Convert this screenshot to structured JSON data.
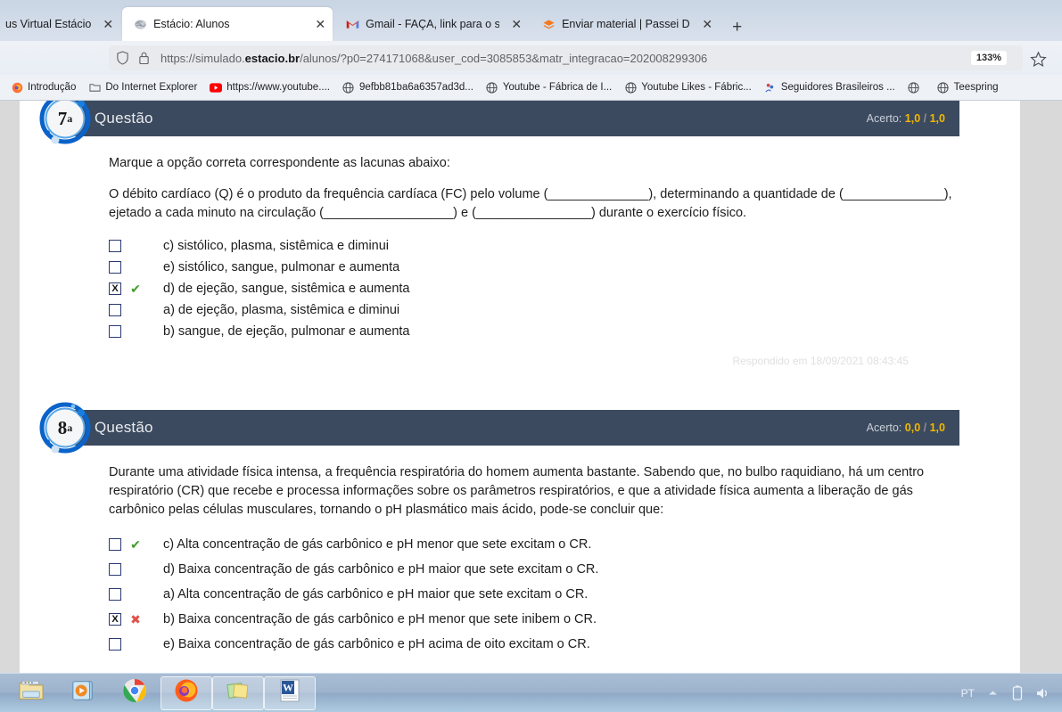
{
  "browser": {
    "tabs": [
      {
        "title": "us Virtual Estácio",
        "favicon": "none-icon",
        "active": false,
        "close_label": "✕"
      },
      {
        "title": "Estácio: Alunos",
        "favicon": "estacio-brain-icon",
        "active": true,
        "close_label": "✕"
      },
      {
        "title": "Gmail - FAÇA, link para o seu ac",
        "favicon": "gmail-icon",
        "active": false,
        "close_label": "✕"
      },
      {
        "title": "Enviar material | Passei Direto | P",
        "favicon": "passeidireto-icon",
        "active": false,
        "close_label": "✕"
      }
    ],
    "new_tab_label": "+",
    "url": {
      "prefix": "https://simulado.",
      "domain": "estacio.br",
      "suffix": "/alunos/?p0=274171068&user_cod=3085853&matr_integracao=202008299306",
      "full": "https://simulado.estacio.br/alunos/?p0=274171068&user_cod=3085853&matr_integracao=202008299306",
      "shield_icon": "shield-icon",
      "lock_icon": "padlock-icon",
      "zoom_level": "133%",
      "bookmark_icon": "star-icon"
    },
    "bookmarks": [
      {
        "label": "Introdução",
        "icon": "firefox-icon"
      },
      {
        "label": "Do Internet Explorer",
        "icon": "folder-icon"
      },
      {
        "label": "https://www.youtube....",
        "icon": "youtube-icon"
      },
      {
        "label": "9efbb81ba6a6357ad3d...",
        "icon": "globe-icon"
      },
      {
        "label": "Youtube - Fábrica de I...",
        "icon": "globe-icon"
      },
      {
        "label": "Youtube Likes - Fábric...",
        "icon": "globe-icon"
      },
      {
        "label": "Seguidores Brasileiros ...",
        "icon": "seguidores-icon"
      },
      {
        "label": "",
        "icon": "globe-icon"
      },
      {
        "label": "Teespring",
        "icon": "globe-icon"
      }
    ]
  },
  "questions": [
    {
      "number": "7",
      "ordinal_suffix": "a",
      "header_label": "Questão",
      "score_label": "Acerto:",
      "score_earned": "1,0",
      "score_separator": "/",
      "score_total": "1,0",
      "statement_lines": [
        "Marque a opção correta correspondente as lacunas abaixo:",
        "O débito cardíaco (Q) é o produto da frequência cardíaca (FC) pelo volume (______________), determinando a quantidade de (______________), ejetado a cada minuto na circulação (__________________) e (________________) durante o exercício físico."
      ],
      "options": [
        {
          "checked": false,
          "mark": "none",
          "label": "c) sistólico, plasma, sistêmica e diminui"
        },
        {
          "checked": false,
          "mark": "none",
          "label": "e) sistólico, sangue, pulmonar e aumenta"
        },
        {
          "checked": true,
          "mark": "correct",
          "label": "d) de ejeção, sangue, sistêmica e aumenta"
        },
        {
          "checked": false,
          "mark": "none",
          "label": "a) de ejeção, plasma, sistêmica e diminui"
        },
        {
          "checked": false,
          "mark": "none",
          "label": "b) sangue, de ejeção, pulmonar e aumenta"
        }
      ],
      "answered_at": "Respondido em 18/09/2021 08:43:45"
    },
    {
      "number": "8",
      "ordinal_suffix": "a",
      "header_label": "Questão",
      "score_label": "Acerto:",
      "score_earned": "0,0",
      "score_separator": "/",
      "score_total": "1,0",
      "statement_lines": [
        "Durante uma atividade física intensa, a frequência respiratória do homem aumenta bastante. Sabendo que, no bulbo raquidiano, há um centro respiratório (CR) que recebe e processa informações sobre os parâmetros respiratórios, e que a atividade física aumenta a liberação de gás carbônico pelas células musculares, tornando o pH plasmático mais ácido, pode-se concluir que:"
      ],
      "options": [
        {
          "checked": false,
          "mark": "correct",
          "label": "c) Alta concentração de gás carbônico e pH menor que sete excitam o CR."
        },
        {
          "checked": false,
          "mark": "none",
          "label": "d) Baixa concentração de gás carbônico e pH maior que sete excitam o CR."
        },
        {
          "checked": false,
          "mark": "none",
          "label": "a) Alta concentração de gás carbônico e pH maior que sete excitam o CR."
        },
        {
          "checked": true,
          "mark": "wrong",
          "label": "b) Baixa concentração de gás carbônico e pH menor que sete inibem o CR."
        },
        {
          "checked": false,
          "mark": "none",
          "label": "e) Baixa concentração de gás carbônico e pH acima de oito excitam o CR."
        }
      ],
      "answered_at": ""
    }
  ],
  "taskbar": {
    "items": [
      {
        "icon": "file-explorer-icon",
        "running": false
      },
      {
        "icon": "media-player-icon",
        "running": false
      },
      {
        "icon": "chrome-icon",
        "running": false
      },
      {
        "icon": "firefox-icon",
        "running": true
      },
      {
        "icon": "sticky-notes-icon",
        "running": true
      },
      {
        "icon": "word-icon",
        "running": true
      }
    ],
    "tray": {
      "language": "PT",
      "show_hidden_icon": "chevron-up-icon",
      "battery_icon": "battery-icon",
      "volume_icon": "volume-icon"
    }
  },
  "colors": {
    "header_bg": "#3b4a5e",
    "score_accent": "#f2b705",
    "correct": "#3f9e28",
    "wrong": "#e0504a",
    "page_bg": "#d9d9d9",
    "checkbox_border": "#2a3a70"
  }
}
